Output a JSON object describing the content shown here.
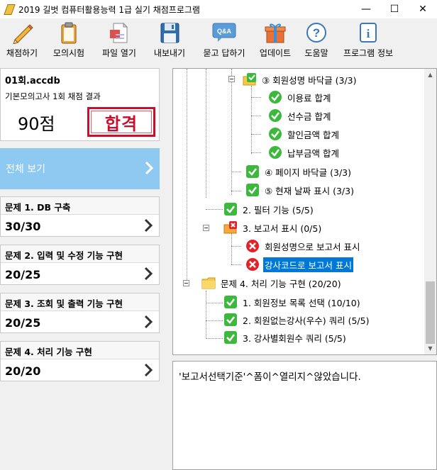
{
  "window": {
    "title": "2019 길벗 컴퓨터활용능력 1급 실기 채점프로그램",
    "minimize": "—",
    "maximize": "☐",
    "close": "✕"
  },
  "toolbar": {
    "items": [
      {
        "label": "채점하기",
        "icon": "pencil-icon"
      },
      {
        "label": "모의시험",
        "icon": "clipboard-icon"
      },
      {
        "label": "파일 열기",
        "icon": "open-file-icon"
      },
      {
        "label": "내보내기",
        "icon": "floppy-disk-icon"
      },
      {
        "label": "묻고 답하기",
        "icon": "qa-bubble-icon",
        "badge": "Q&A"
      },
      {
        "label": "업데이트",
        "icon": "gift-box-icon"
      },
      {
        "label": "도움말",
        "icon": "help-icon",
        "glyph": "?"
      },
      {
        "label": "프로그램 정보",
        "icon": "info-icon",
        "glyph": "i"
      }
    ]
  },
  "summary": {
    "file_name": "01회.accdb",
    "result_label": "기본모의고사 1회 채점 결과",
    "score": "90점",
    "pass_stamp": "합격"
  },
  "view_all": {
    "label": "전체 보기"
  },
  "problems": [
    {
      "title": "문제 1. DB 구축",
      "score": "30/30"
    },
    {
      "title": "문제 2. 입력 및 수정 기능 구현",
      "score": "20/25"
    },
    {
      "title": "문제 3. 조회 및 출력 기능 구현",
      "score": "20/25"
    },
    {
      "title": "문제 4. 처리 기능 구현",
      "score": "20/20"
    }
  ],
  "tree": {
    "nodes": [
      {
        "text": "③ 회원성명 바닥글 (3/3)",
        "icon": "folder-check-icon"
      },
      {
        "text": "이용료 합계",
        "icon": "check-icon"
      },
      {
        "text": "선수금 합계",
        "icon": "check-icon"
      },
      {
        "text": "할인금액 합계",
        "icon": "check-icon"
      },
      {
        "text": "납부금액 합계",
        "icon": "check-icon"
      },
      {
        "text": "④ 페이지 바닥글 (3/3)",
        "icon": "check-box-icon"
      },
      {
        "text": "⑤ 현재 날짜 표시 (3/3)",
        "icon": "check-box-icon"
      },
      {
        "text": "2. 필터 기능 (5/5)",
        "icon": "check-box-icon"
      },
      {
        "text": "3. 보고서 표시 (0/5)",
        "icon": "folder-error-icon"
      },
      {
        "text": "회원성명으로 보고서 표시",
        "icon": "error-icon"
      },
      {
        "text": "강사코드로 보고서 표시",
        "icon": "error-icon",
        "selected": true
      },
      {
        "text": "문제 4. 처리 기능 구현 (20/20)",
        "icon": "folder-icon"
      },
      {
        "text": "1. 회원정보 목록 선택 (10/10)",
        "icon": "check-box-icon"
      },
      {
        "text": "2. 회원없는강사(우수) 쿼리 (5/5)",
        "icon": "check-box-icon"
      },
      {
        "text": "3. 강사별회원수 쿼리 (5/5)",
        "icon": "check-box-icon"
      }
    ]
  },
  "message": "'보고서선택기준'^폼이^열리지^않았습니다.",
  "colors": {
    "view_all_bg": "#8ec9f2",
    "selection": "#0078d7",
    "check_green": "#3cb93c",
    "error_red": "#e0242c",
    "stamp_red": "#c8102e"
  }
}
